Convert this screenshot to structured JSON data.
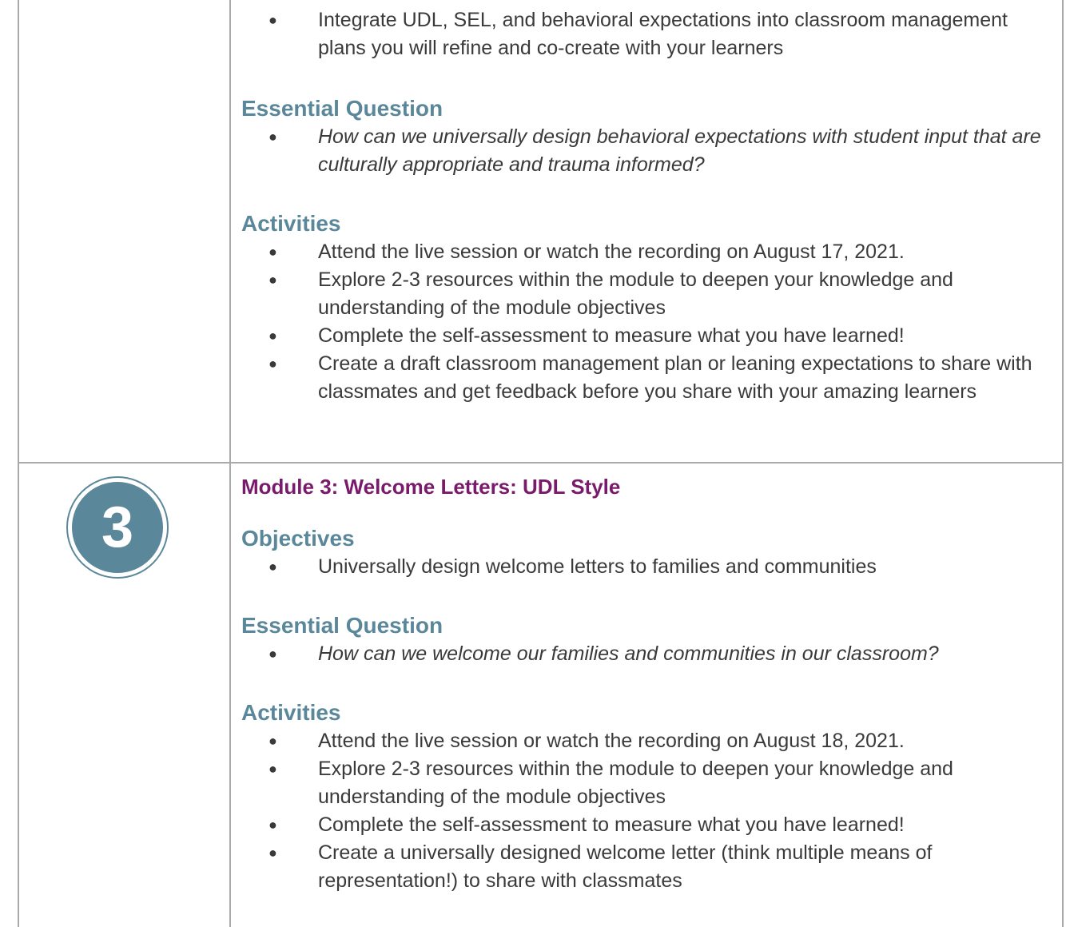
{
  "module2": {
    "objectives_continued": [
      "Integrate UDL, SEL, and behavioral expectations into classroom management plans you will refine and  co-create with your learners"
    ],
    "essential_question_heading": "Essential Question",
    "essential_question": "How can we universally design behavioral expectations with student input that are culturally appropriate and trauma informed?",
    "activities_heading": "Activities",
    "activities": [
      "Attend the live session or watch the recording on August 17, 2021.",
      "Explore 2-3 resources within the module to deepen your knowledge and understanding of the module objectives",
      "Complete the self-assessment to measure what you have learned!",
      "Create a draft classroom management plan or leaning expectations to share with classmates and get feedback before you share with your amazing learners"
    ]
  },
  "module3": {
    "badge_number": "3",
    "title": "Module 3:  Welcome Letters: UDL Style",
    "objectives_heading": "Objectives",
    "objectives": [
      "Universally design welcome letters to families and communities"
    ],
    "essential_question_heading": "Essential Question",
    "essential_question": "How can we welcome our families and communities in our classroom?",
    "activities_heading": "Activities",
    "activities": [
      "Attend the live session or watch the recording on August 18, 2021.",
      "Explore 2-3 resources within the module to deepen your knowledge and understanding of the module objectives",
      "Complete the self-assessment to measure what you have learned!",
      "Create a universally designed welcome letter (think multiple means of representation!) to share with classmates"
    ]
  },
  "colors": {
    "heading": "#5a8799",
    "module_title": "#7a1a6a",
    "border": "#a9a9a9"
  }
}
